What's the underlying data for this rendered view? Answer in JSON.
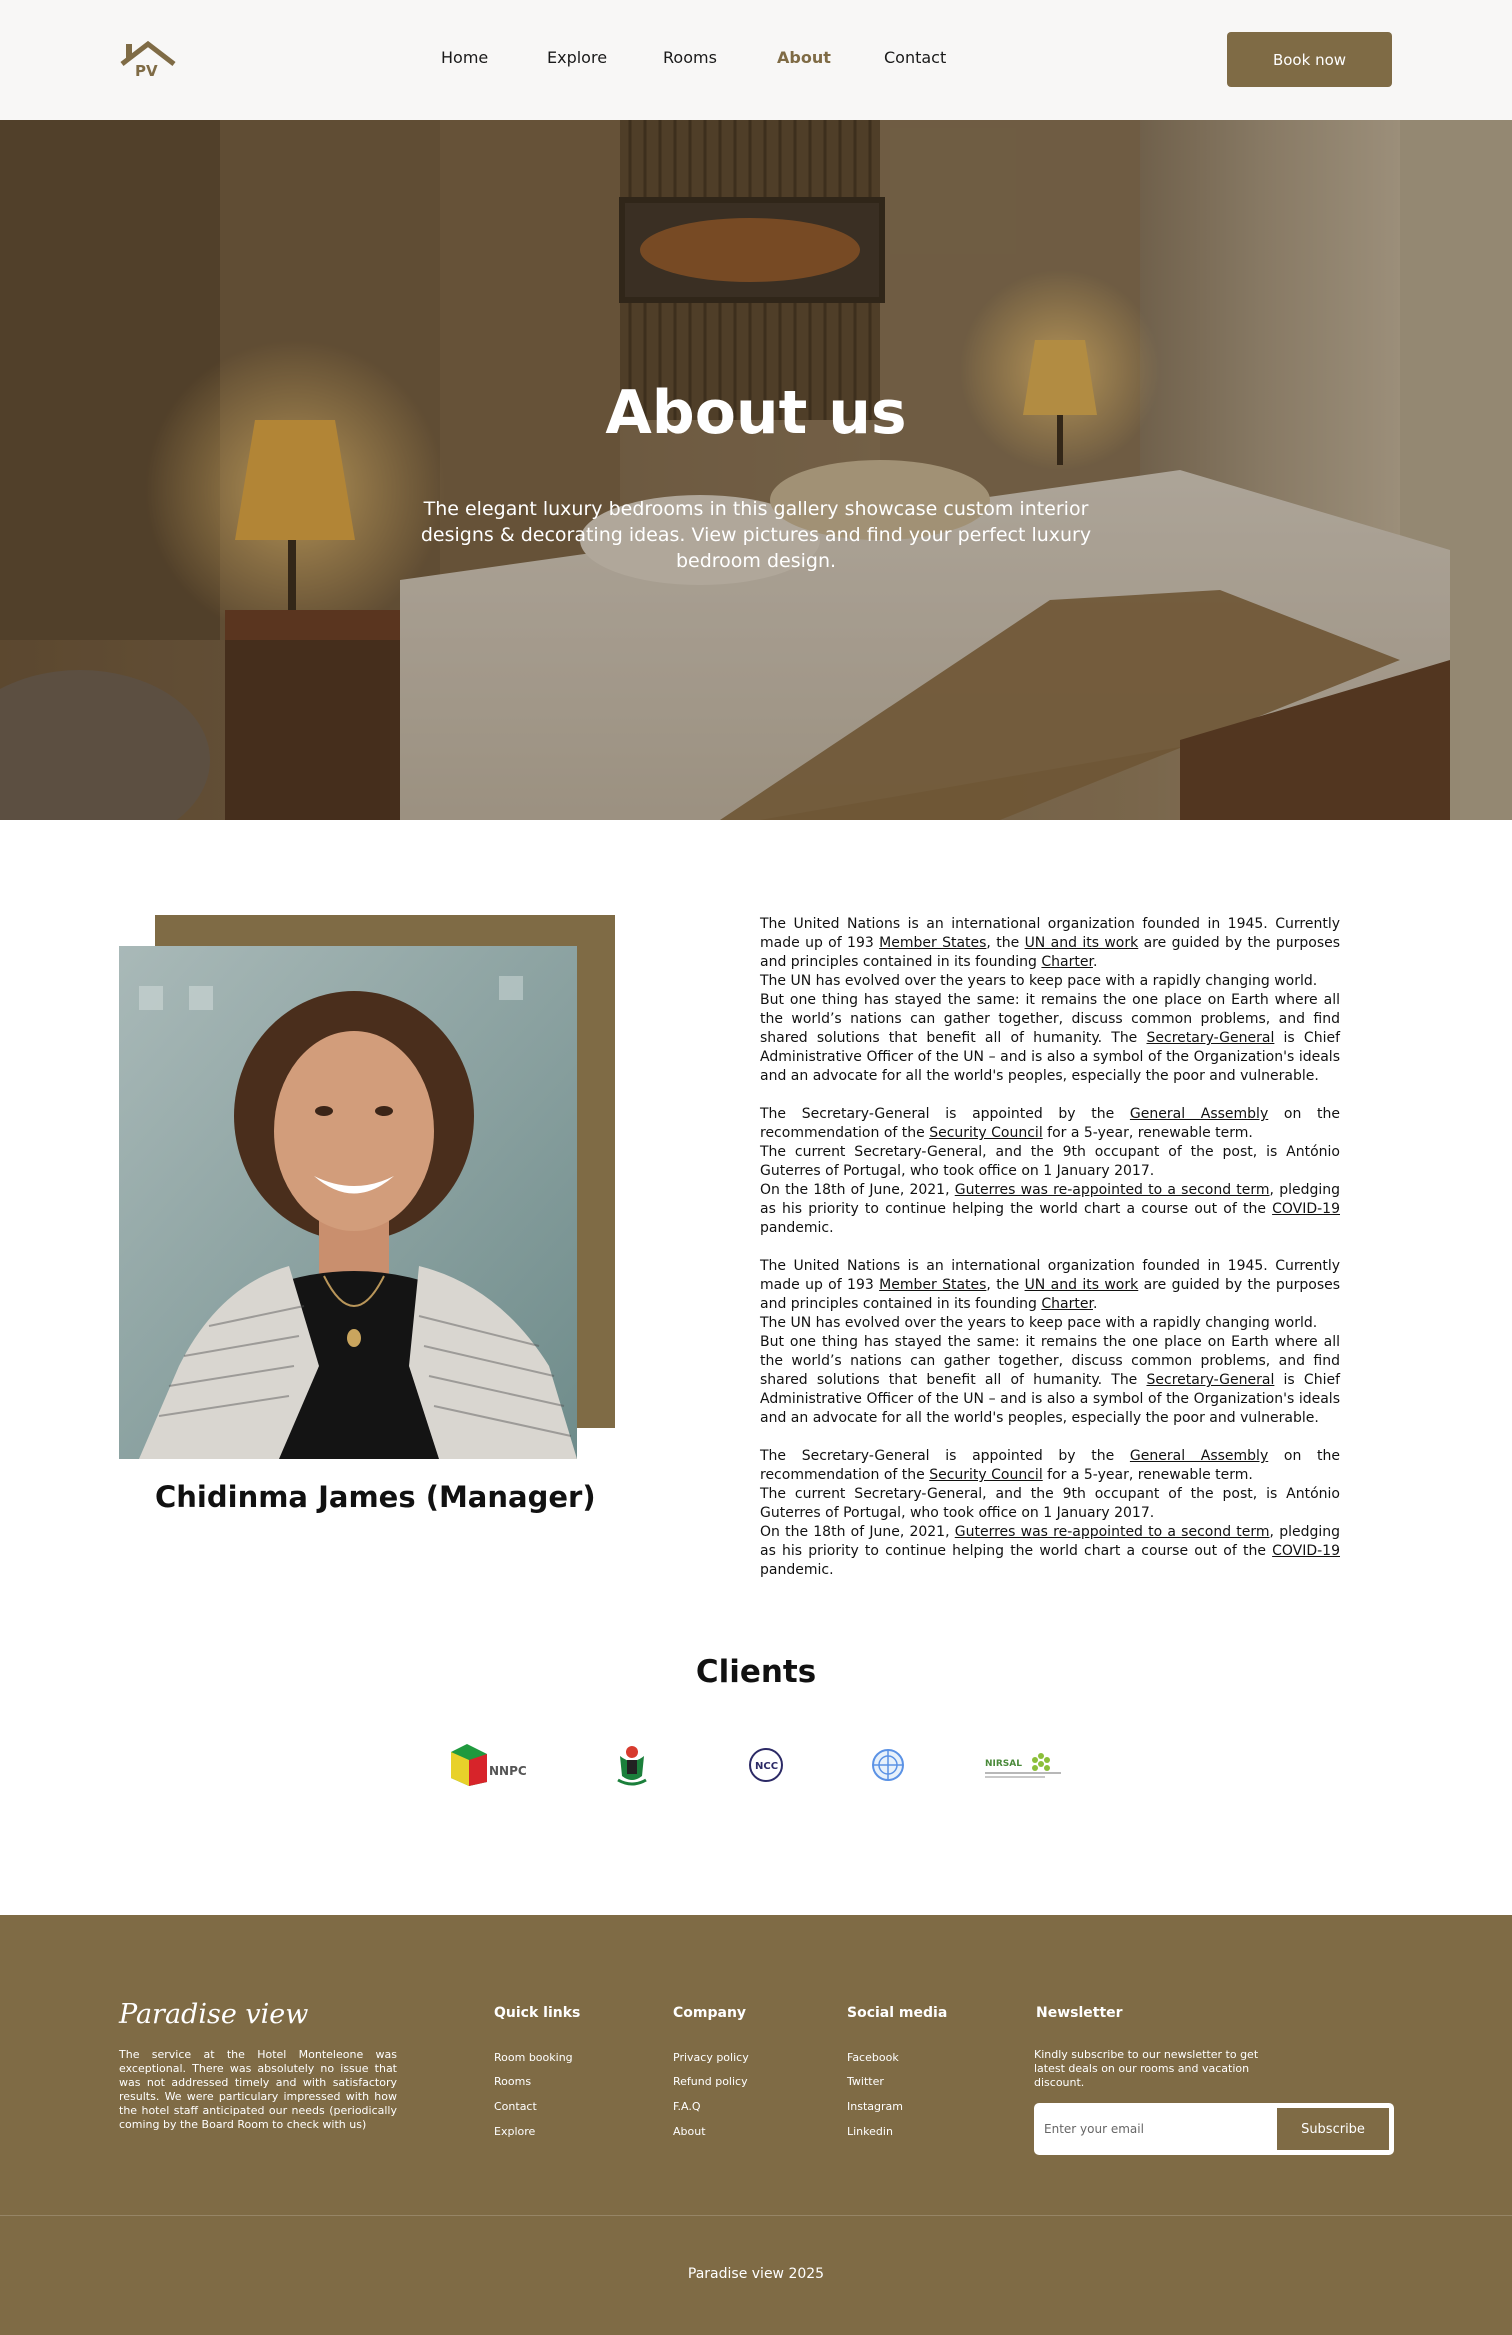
{
  "nav": {
    "logo_text": "PV",
    "links": [
      {
        "label": "Home",
        "active": false
      },
      {
        "label": "Explore",
        "active": false
      },
      {
        "label": "Rooms",
        "active": false
      },
      {
        "label": "About",
        "active": true
      },
      {
        "label": "Contact",
        "active": false
      }
    ],
    "cta_label": "Book now"
  },
  "hero": {
    "title": "About us",
    "subtitle": "The elegant luxury bedrooms in this gallery showcase custom interior designs & decorating ideas. View pictures and find your perfect luxury bedroom design."
  },
  "about": {
    "manager_name": "Chidinma James (Manager)",
    "blocks": [
      {
        "p1": [
          "The United Nations is an international organization founded in 1945. Currently made up of 193 ",
          "Member States",
          ", the ",
          "UN and its work",
          " are guided by the purposes and principles contained in its founding ",
          "Charter",
          "."
        ],
        "p2": "The UN has evolved over the years to keep pace with a rapidly changing world.",
        "p3": [
          "But one thing has stayed the same: it remains the one place on Earth where all the world’s nations can gather together, discuss common problems, and find shared solutions that benefit all of humanity. The ",
          "Secretary-General",
          " is Chief Administrative Officer of the UN – and is also a symbol of the Organization's ideals and an advocate for all the world's peoples, especially the poor and vulnerable."
        ],
        "p4": [
          "The Secretary-General is appointed by the ",
          "General Assembly",
          " on the recommendation of the ",
          "Security Council",
          " for a 5-year, renewable term."
        ],
        "p5": "The current Secretary-General, and the 9th occupant of the post, is António Guterres of Portugal, who took office on 1 January 2017.",
        "p6": [
          "On the 18th of June, 2021, ",
          "Guterres was re-appointed to a second term",
          ", pledging as his priority to continue helping the world chart a course out of the ",
          "COVID-19",
          " pandemic."
        ]
      },
      {
        "p1": [
          "The United Nations is an international organization founded in 1945. Currently made up of 193 ",
          "Member States",
          ", the ",
          "UN and its work",
          " are guided by the purposes and principles contained in its founding ",
          "Charter",
          "."
        ],
        "p2": "The UN has evolved over the years to keep pace with a rapidly changing world.",
        "p3": [
          "But one thing has stayed the same: it remains the one place on Earth where all the world’s nations can gather together, discuss common problems, and find shared solutions that benefit all of humanity. The ",
          "Secretary-General",
          " is Chief Administrative Officer of the UN – and is also a symbol of the Organization's ideals and an advocate for all the world's peoples, especially the poor and vulnerable."
        ],
        "p4": [
          "The Secretary-General is appointed by the ",
          "General Assembly",
          " on the recommendation of the ",
          "Security Council",
          " for a 5-year, renewable term."
        ],
        "p5": "The current Secretary-General, and the 9th occupant of the post, is António Guterres of Portugal, who took office on 1 January 2017.",
        "p6": [
          "On the 18th of June, 2021, ",
          "Guterres was re-appointed to a second term",
          ", pledging as his priority to continue helping the world chart a course out of the ",
          "COVID-19",
          " pandemic."
        ]
      }
    ]
  },
  "clients": {
    "title": "Clients",
    "logos": [
      {
        "icon": "nnpc-logo",
        "text": "NNPC"
      },
      {
        "icon": "nigeria-coat-of-arms-logo",
        "text": ""
      },
      {
        "icon": "ncc-logo",
        "text": "NCC"
      },
      {
        "icon": "united-nations-logo",
        "text": ""
      },
      {
        "icon": "nirsal-logo",
        "text": "NIRSAL"
      }
    ]
  },
  "footer": {
    "brand": "Paradise view",
    "description": "The service at the Hotel Monteleone was exceptional. There was absolutely no issue that was not addressed timely and with satisfactory results. We were particulary impressed with how the hotel staff anticipated our needs (periodically coming by the Board Room to check with us)",
    "columns": [
      {
        "title": "Quick links",
        "links": [
          "Room booking",
          "Rooms",
          "Contact",
          "Explore"
        ]
      },
      {
        "title": "Company",
        "links": [
          "Privacy policy",
          "Refund policy",
          "F.A.Q",
          "About"
        ]
      },
      {
        "title": "Social media",
        "links": [
          "Facebook",
          "Twitter",
          "Instagram",
          "Linkedin"
        ]
      }
    ],
    "newsletter": {
      "title": "Newsletter",
      "description": "Kindly subscribe to our newsletter to get latest deals on our rooms and vacation discount.",
      "placeholder": "Enter your email",
      "button": "Subscribe"
    },
    "copyright": "Paradise view 2025"
  },
  "colors": {
    "brand": "#7f6b45",
    "nav_bg": "#f8f7f6",
    "text": "#111111"
  }
}
